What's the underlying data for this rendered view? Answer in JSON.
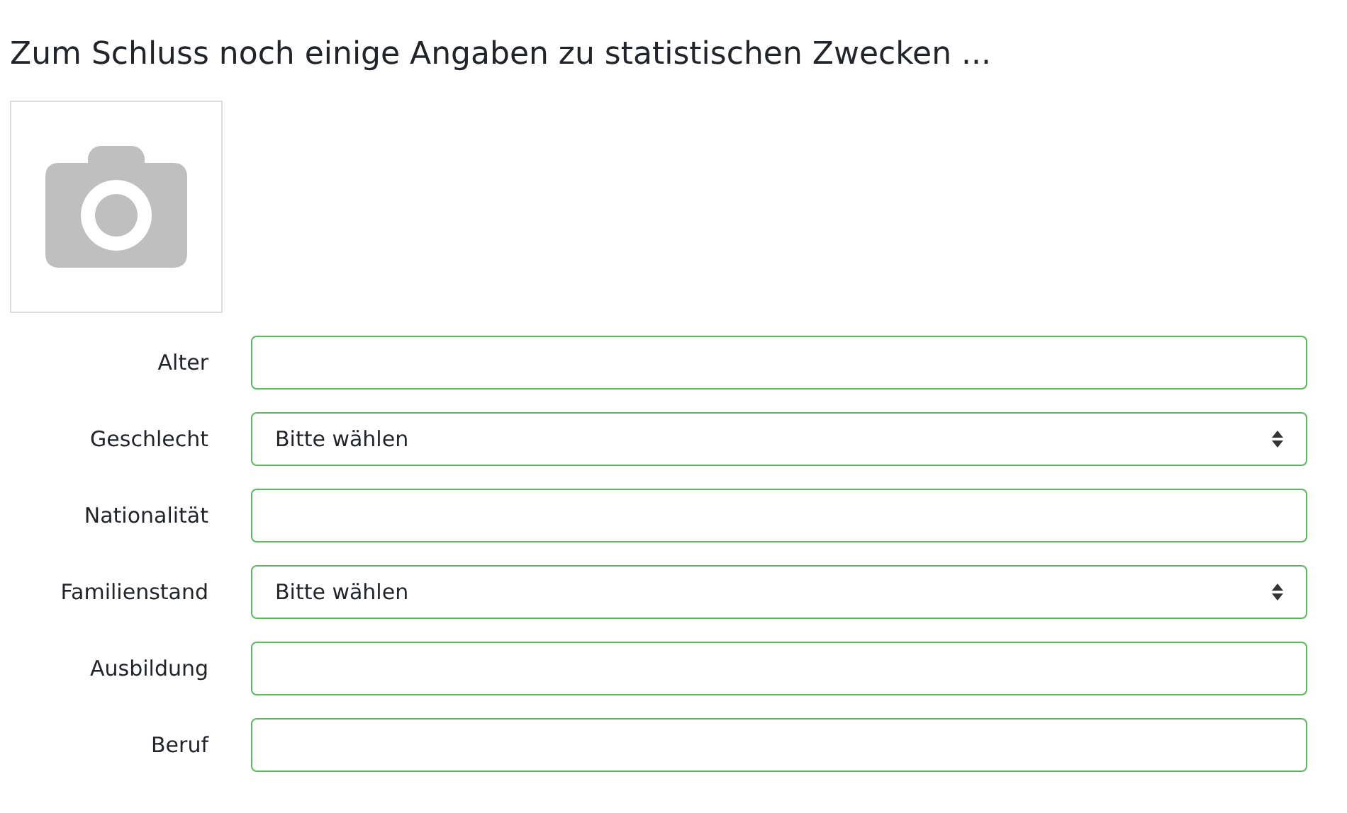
{
  "heading": "Zum Schluss noch einige Angaben zu statistischen Zwecken ...",
  "photo": {
    "kind": "placeholder"
  },
  "fields": [
    {
      "label": "Alter",
      "kind": "text"
    },
    {
      "label": "Geschlecht",
      "kind": "select",
      "value": "Bitte wählen"
    },
    {
      "label": "Nationalität",
      "kind": "text"
    },
    {
      "label": "Familienstand",
      "kind": "select",
      "value": "Bitte wählen"
    },
    {
      "label": "Ausbildung",
      "kind": "text"
    },
    {
      "label": "Beruf",
      "kind": "text"
    }
  ]
}
